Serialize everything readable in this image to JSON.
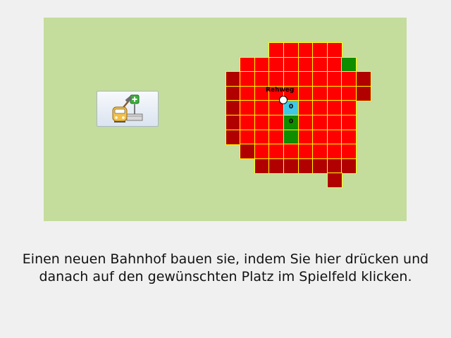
{
  "board": {
    "palette": {
      "R": "#ff0000",
      "D": "#b00000",
      "G": "#108c00",
      "C": "#3fc8e8",
      "border": "#ffff00",
      "background": "#c4dc9c"
    },
    "rows": [
      "....RRRRR...",
      "..RRRRRRRG..",
      ".DRRRRRRRRD.",
      ".DRRRRRRRRD.",
      ".DRRRCRRRR..",
      ".DRRRGRRRR..",
      ".DRRRGRRRR..",
      "..DRRRRRRR..",
      "...DDDDDDD..",
      "........D..."
    ],
    "cell_labels": [
      {
        "row": 4,
        "col": 5,
        "text": "0"
      },
      {
        "row": 5,
        "col": 5,
        "text": "0"
      }
    ],
    "station_name": "Rehweg"
  },
  "build_button": {
    "icon": "build-station-icon"
  },
  "hint": "Einen neuen Bahnhof bauen sie, indem Sie hier drücken und danach auf den gewünschten Platz im Spielfeld klicken."
}
